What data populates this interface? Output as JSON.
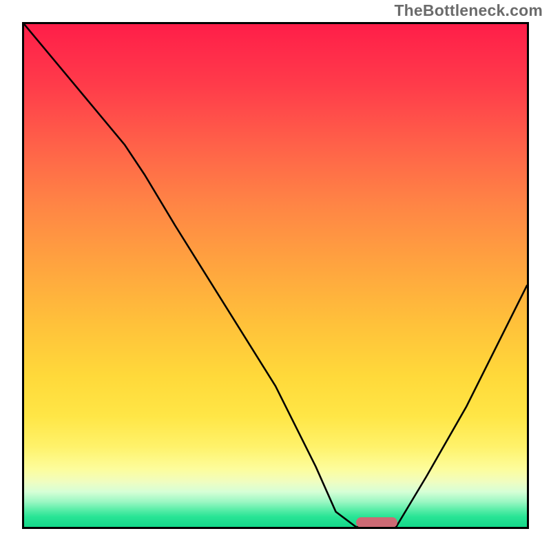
{
  "watermark": "TheBottleneck.com",
  "marker": {
    "x_pct": 65.5,
    "width_pct": 8.2,
    "y_pct": 97.3
  },
  "chart_data": {
    "type": "line",
    "title": "",
    "xlabel": "",
    "ylabel": "",
    "xlim": [
      0,
      100
    ],
    "ylim": [
      0,
      100
    ],
    "grid": false,
    "legend": false,
    "gradient_stops": [
      {
        "pos": 0,
        "color": "#ff1e49"
      },
      {
        "pos": 36,
        "color": "#ff8545"
      },
      {
        "pos": 70,
        "color": "#ffd93a"
      },
      {
        "pos": 91,
        "color": "#d6ffd6"
      },
      {
        "pos": 100,
        "color": "#14d889"
      }
    ],
    "series": [
      {
        "name": "curve",
        "x": [
          0,
          10,
          20,
          24,
          30,
          40,
          50,
          58,
          62,
          66,
          74,
          80,
          88,
          100
        ],
        "y": [
          100,
          88,
          76,
          70,
          60,
          44,
          28,
          12,
          3,
          0,
          0,
          10,
          24,
          48
        ]
      }
    ],
    "annotations": [
      {
        "type": "rounded_bar",
        "x_center_pct": 69.5,
        "width_pct": 8.2,
        "y_pct_from_top": 97.3,
        "color": "#cc6a74"
      }
    ]
  }
}
